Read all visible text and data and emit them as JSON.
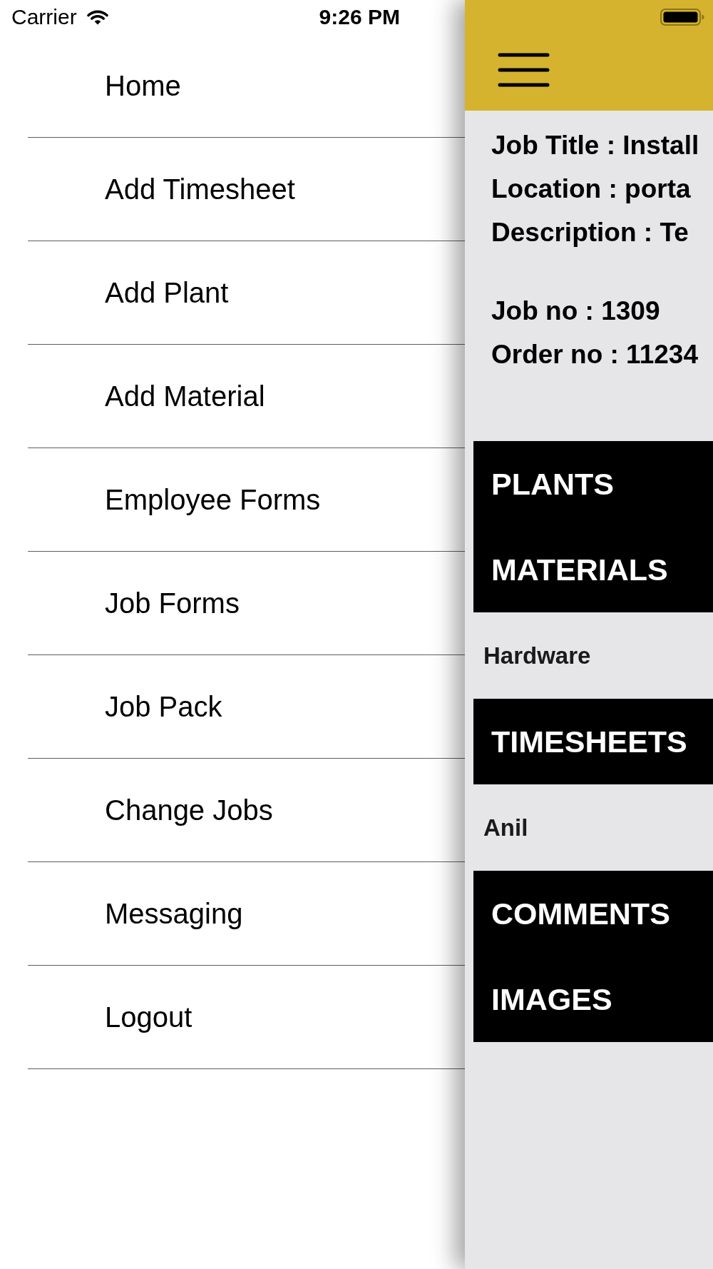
{
  "status_bar": {
    "carrier": "Carrier",
    "time": "9:26 PM"
  },
  "menu": {
    "items": [
      {
        "label": "Home"
      },
      {
        "label": "Add Timesheet"
      },
      {
        "label": "Add Plant"
      },
      {
        "label": "Add Material"
      },
      {
        "label": "Employee Forms"
      },
      {
        "label": "Job Forms"
      },
      {
        "label": "Job Pack"
      },
      {
        "label": "Change Jobs"
      },
      {
        "label": "Messaging"
      },
      {
        "label": "Logout"
      }
    ]
  },
  "job_panel": {
    "details": [
      "Job Title : Install",
      "Location : porta",
      "Description : Te"
    ],
    "numbers": [
      "Job no : 1309",
      "Order no : 11234"
    ],
    "blocks": [
      {
        "kind": "bar",
        "labels": [
          "PLANTS",
          "MATERIALS"
        ]
      },
      {
        "kind": "entry",
        "text": "Hardware"
      },
      {
        "kind": "bar",
        "labels": [
          "TIMESHEETS"
        ]
      },
      {
        "kind": "entry",
        "text": "Anil"
      },
      {
        "kind": "bar",
        "labels": [
          "COMMENTS",
          "IMAGES"
        ]
      }
    ]
  }
}
